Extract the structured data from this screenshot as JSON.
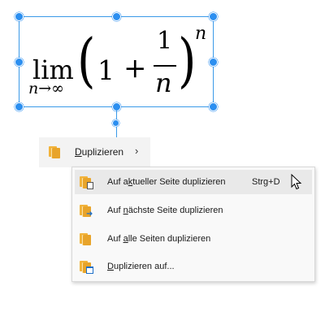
{
  "formula": {
    "lim": "lim",
    "subscript": "n→∞",
    "lparen": "(",
    "one": "1",
    "plus": "+",
    "numerator": "1",
    "denominator": "n",
    "rparen": ")",
    "exponent": "n"
  },
  "context_menu": {
    "item": {
      "icon": "duplicate-pages-icon",
      "label_accel": "D",
      "label_rest": "uplizieren",
      "chevron": "›"
    }
  },
  "submenu": {
    "items": [
      {
        "icon": "duplicate-current-page-icon",
        "label_pre": "Auf a",
        "label_accel": "k",
        "label_post": "tueller Seite duplizieren",
        "shortcut": "Strg+D",
        "highlighted": true
      },
      {
        "icon": "duplicate-next-page-icon",
        "label_pre": "Auf ",
        "label_accel": "n",
        "label_post": "ächste Seite duplizieren"
      },
      {
        "icon": "duplicate-all-pages-icon",
        "label_pre": "Auf ",
        "label_accel": "a",
        "label_post": "lle Seiten duplizieren"
      },
      {
        "icon": "duplicate-to-icon",
        "label_pre": "",
        "label_accel": "D",
        "label_post": "uplizieren auf..."
      }
    ]
  },
  "colors": {
    "selection": "#3b9ae8",
    "handle": "#2c8ff0",
    "icon_orange": "#e8a42a",
    "icon_blue": "#1e6fc8"
  }
}
